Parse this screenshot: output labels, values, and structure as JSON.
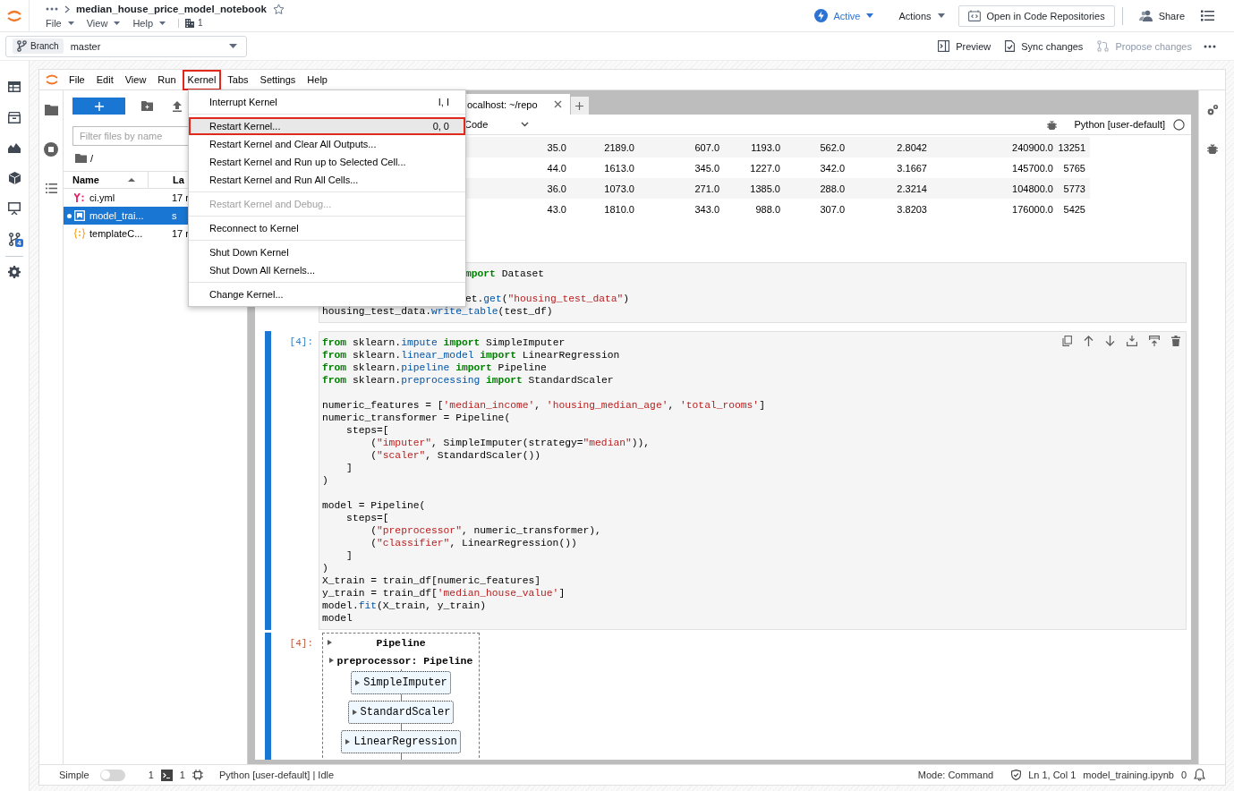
{
  "header": {
    "title": "median_house_price_model_notebook",
    "starred": false,
    "menus": [
      "File",
      "View",
      "Help"
    ],
    "building_count": "1",
    "status": "Active",
    "actions": "Actions",
    "open_repo": "Open in Code Repositories",
    "share": "Share"
  },
  "branch_bar": {
    "chip": "Branch",
    "value": "master",
    "actions": [
      {
        "kind": "preview",
        "label": "Preview",
        "disabled": false
      },
      {
        "kind": "sync",
        "label": "Sync changes",
        "disabled": false
      },
      {
        "kind": "propose",
        "label": "Propose changes",
        "disabled": true
      }
    ]
  },
  "app_rail": {
    "top": [
      {
        "kind": "table"
      },
      {
        "kind": "archive"
      },
      {
        "kind": "chart"
      },
      {
        "kind": "cube"
      },
      {
        "kind": "presentation"
      },
      {
        "kind": "branch",
        "badge": "4"
      }
    ],
    "bottom": [
      {
        "kind": "gear"
      }
    ]
  },
  "jupyter": {
    "menubar": [
      {
        "label": "File",
        "annotated": false
      },
      {
        "label": "Edit",
        "annotated": false
      },
      {
        "label": "View",
        "annotated": false
      },
      {
        "label": "Run",
        "annotated": false
      },
      {
        "label": "Kernel",
        "annotated": true
      },
      {
        "label": "Tabs",
        "annotated": false
      },
      {
        "label": "Settings",
        "annotated": false
      },
      {
        "label": "Help",
        "annotated": false
      }
    ],
    "kernel_menu": {
      "groups": [
        [
          {
            "label": "Interrupt Kernel",
            "shortcut": "I, I",
            "active": false,
            "annotated": false,
            "disabled": false
          }
        ],
        [
          {
            "label": "Restart Kernel...",
            "shortcut": "0, 0",
            "active": true,
            "annotated": true,
            "disabled": false
          },
          {
            "label": "Restart Kernel and Clear All Outputs...",
            "active": false,
            "annotated": false,
            "disabled": false
          },
          {
            "label": "Restart Kernel and Run up to Selected Cell...",
            "active": false,
            "annotated": false,
            "disabled": false
          },
          {
            "label": "Restart Kernel and Run All Cells...",
            "active": false,
            "annotated": false,
            "disabled": false
          }
        ],
        [
          {
            "label": "Restart Kernel and Debug...",
            "active": false,
            "annotated": false,
            "disabled": true
          }
        ],
        [
          {
            "label": "Reconnect to Kernel",
            "active": false,
            "annotated": false,
            "disabled": false
          }
        ],
        [
          {
            "label": "Shut Down Kernel",
            "active": false,
            "annotated": false,
            "disabled": false
          },
          {
            "label": "Shut Down All Kernels...",
            "active": false,
            "annotated": false,
            "disabled": false
          }
        ],
        [
          {
            "label": "Change Kernel...",
            "active": false,
            "annotated": false,
            "disabled": false
          }
        ]
      ]
    },
    "file_browser": {
      "filter_placeholder": "Filter files by name",
      "path": "/",
      "columns": [
        "Name",
        "La"
      ],
      "files": [
        {
          "kind": "yaml",
          "name": "ci.yml",
          "modified": "17 r",
          "selected": false,
          "running": false
        },
        {
          "kind": "notebook",
          "name": "model_trai...",
          "modified": "s",
          "selected": true,
          "running": true
        },
        {
          "kind": "json",
          "name": "templateC...",
          "modified": "17 r",
          "selected": false,
          "running": false
        }
      ]
    },
    "notebook": {
      "tab": "ocalhost: ~/repo",
      "cell_type": "Code",
      "kernel_name": "Python [user-default]",
      "kernel_busy": false,
      "table_rows": [
        [
          "35.0",
          "2189.0",
          "607.0",
          "1193.0",
          "562.0",
          "2.8042",
          "240900.0",
          "13251"
        ],
        [
          "44.0",
          "1613.0",
          "345.0",
          "1227.0",
          "342.0",
          "3.1667",
          "145700.0",
          "5765"
        ],
        [
          "36.0",
          "1073.0",
          "271.0",
          "1385.0",
          "288.0",
          "2.3214",
          "104800.0",
          "5773"
        ],
        [
          "43.0",
          "1810.0",
          "343.0",
          "988.0",
          "307.0",
          "3.8203",
          "176000.0",
          "5425"
        ]
      ],
      "partial_cell": {
        "blocks": [
          [
            {
              "clipped": true,
              "tokens": [
                {
                  "t": "mport",
                  "kind": "keyword"
                },
                {
                  "t": " Dataset",
                  "kind": "plain"
                }
              ]
            }
          ],
          [
            {
              "clipped": true,
              "tokens": [
                {
                  "t": "et.",
                  "kind": "plain"
                },
                {
                  "t": "get",
                  "kind": "name"
                },
                {
                  "t": "(",
                  "kind": "plain"
                },
                {
                  "t": "\"housing_test_data\"",
                  "kind": "string"
                },
                {
                  "t": ")",
                  "kind": "plain"
                }
              ]
            },
            {
              "clipped": false,
              "tokens": [
                {
                  "t": "housing_test_data.",
                  "kind": "plain"
                },
                {
                  "t": "write_table",
                  "kind": "name"
                },
                {
                  "t": "(test_df)",
                  "kind": "plain"
                }
              ]
            }
          ]
        ]
      },
      "cell": {
        "active": true,
        "prompt": "[4]:",
        "blocks": [
          [
            [
              {
                "t": "from",
                "kind": "keyword"
              },
              {
                "t": " sklearn.",
                "kind": "plain"
              },
              {
                "t": "impute",
                "kind": "name"
              },
              {
                "t": " import",
                "kind": "keyword"
              },
              {
                "t": " SimpleImputer",
                "kind": "plain"
              }
            ],
            [
              {
                "t": "from",
                "kind": "keyword"
              },
              {
                "t": " sklearn.",
                "kind": "plain"
              },
              {
                "t": "linear_model",
                "kind": "name"
              },
              {
                "t": " import",
                "kind": "keyword"
              },
              {
                "t": " LinearRegression",
                "kind": "plain"
              }
            ],
            [
              {
                "t": "from",
                "kind": "keyword"
              },
              {
                "t": " sklearn.",
                "kind": "plain"
              },
              {
                "t": "pipeline",
                "kind": "name"
              },
              {
                "t": " import",
                "kind": "keyword"
              },
              {
                "t": " Pipeline",
                "kind": "plain"
              }
            ],
            [
              {
                "t": "from",
                "kind": "keyword"
              },
              {
                "t": " sklearn.",
                "kind": "plain"
              },
              {
                "t": "preprocessing",
                "kind": "name"
              },
              {
                "t": " import",
                "kind": "keyword"
              },
              {
                "t": " StandardScaler",
                "kind": "plain"
              }
            ]
          ],
          [
            [
              {
                "t": "numeric_features = [",
                "kind": "plain"
              },
              {
                "t": "'median_income'",
                "kind": "string"
              },
              {
                "t": ", ",
                "kind": "plain"
              },
              {
                "t": "'housing_median_age'",
                "kind": "string"
              },
              {
                "t": ", ",
                "kind": "plain"
              },
              {
                "t": "'total_rooms'",
                "kind": "string"
              },
              {
                "t": "]",
                "kind": "plain"
              }
            ],
            [
              {
                "t": "numeric_transformer = Pipeline(",
                "kind": "plain"
              }
            ],
            [
              {
                "t": "    steps=[",
                "kind": "plain"
              }
            ],
            [
              {
                "t": "        (",
                "kind": "plain"
              },
              {
                "t": "\"imputer\"",
                "kind": "string"
              },
              {
                "t": ", SimpleImputer(strategy=",
                "kind": "plain"
              },
              {
                "t": "\"median\"",
                "kind": "string"
              },
              {
                "t": ")),",
                "kind": "plain"
              }
            ],
            [
              {
                "t": "        (",
                "kind": "plain"
              },
              {
                "t": "\"scaler\"",
                "kind": "string"
              },
              {
                "t": ", StandardScaler())",
                "kind": "plain"
              }
            ],
            [
              {
                "t": "    ]",
                "kind": "plain"
              }
            ],
            [
              {
                "t": ")",
                "kind": "plain"
              }
            ]
          ],
          [
            [
              {
                "t": "model = Pipeline(",
                "kind": "plain"
              }
            ],
            [
              {
                "t": "    steps=[",
                "kind": "plain"
              }
            ],
            [
              {
                "t": "        (",
                "kind": "plain"
              },
              {
                "t": "\"preprocessor\"",
                "kind": "string"
              },
              {
                "t": ", numeric_transformer),",
                "kind": "plain"
              }
            ],
            [
              {
                "t": "        (",
                "kind": "plain"
              },
              {
                "t": "\"classifier\"",
                "kind": "string"
              },
              {
                "t": ", LinearRegression())",
                "kind": "plain"
              }
            ],
            [
              {
                "t": "    ]",
                "kind": "plain"
              }
            ],
            [
              {
                "t": ")",
                "kind": "plain"
              }
            ],
            [
              {
                "t": "X_train = train_df[numeric_features]",
                "kind": "plain"
              }
            ],
            [
              {
                "t": "y_train = train_df[",
                "kind": "plain"
              },
              {
                "t": "'median_house_value'",
                "kind": "string"
              },
              {
                "t": "]",
                "kind": "plain"
              }
            ],
            [
              {
                "t": "model.",
                "kind": "plain"
              },
              {
                "t": "fit",
                "kind": "name"
              },
              {
                "t": "(X_train, y_train)",
                "kind": "plain"
              }
            ],
            [
              {
                "t": "model",
                "kind": "plain"
              }
            ]
          ]
        ],
        "output": {
          "prompt": "[4]:",
          "title": "Pipeline",
          "stage": "preprocessor: Pipeline",
          "steps": [
            "SimpleImputer",
            "StandardScaler",
            "LinearRegression"
          ]
        }
      }
    },
    "status_bar": {
      "mode_label": "Simple",
      "simple": false,
      "terminals": "1",
      "kernels": "1",
      "kernel_status": "Python [user-default] | Idle",
      "mode": "Mode: Command",
      "position": "Ln 1, Col 1",
      "file": "model_training.ipynb",
      "notifications": "0"
    }
  }
}
